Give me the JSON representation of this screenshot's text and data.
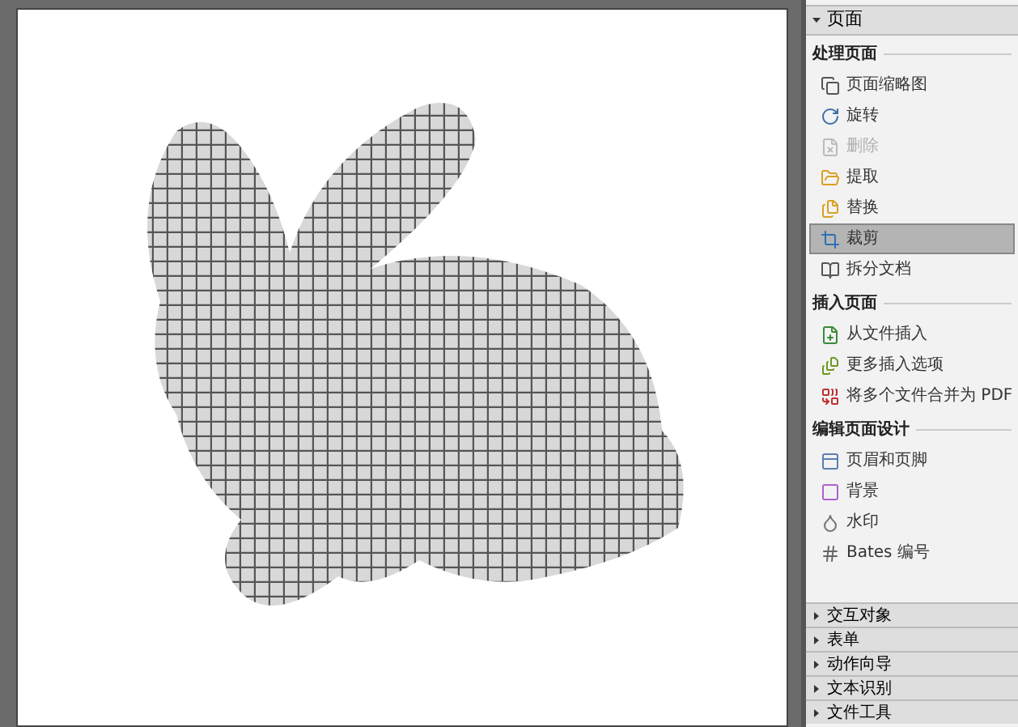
{
  "panel": {
    "title": "页面",
    "expanded": true,
    "sections": [
      {
        "title": "处理页面",
        "items": [
          {
            "label": "页面缩略图",
            "selected": false,
            "disabled": false
          },
          {
            "label": "旋转",
            "selected": false,
            "disabled": false
          },
          {
            "label": "删除",
            "selected": false,
            "disabled": true
          },
          {
            "label": "提取",
            "selected": false,
            "disabled": false
          },
          {
            "label": "替换",
            "selected": false,
            "disabled": false
          },
          {
            "label": "裁剪",
            "selected": true,
            "disabled": false
          },
          {
            "label": "拆分文档",
            "selected": false,
            "disabled": false
          }
        ]
      },
      {
        "title": "插入页面",
        "items": [
          {
            "label": "从文件插入",
            "selected": false,
            "disabled": false
          },
          {
            "label": "更多插入选项",
            "selected": false,
            "disabled": false
          },
          {
            "label": "将多个文件合并为 PDF",
            "selected": false,
            "disabled": false
          }
        ]
      },
      {
        "title": "编辑页面设计",
        "items": [
          {
            "label": "页眉和页脚",
            "selected": false,
            "disabled": false
          },
          {
            "label": "背景",
            "selected": false,
            "disabled": false
          },
          {
            "label": "水印",
            "selected": false,
            "disabled": false
          },
          {
            "label": "Bates 编号",
            "selected": false,
            "disabled": false
          }
        ]
      }
    ]
  },
  "collapsed_panels": [
    {
      "title": "交互对象",
      "expanded": false
    },
    {
      "title": "表单",
      "expanded": false
    },
    {
      "title": "动作向导",
      "expanded": false
    },
    {
      "title": "文本识别",
      "expanded": false
    },
    {
      "title": "文件工具",
      "expanded": false
    }
  ]
}
